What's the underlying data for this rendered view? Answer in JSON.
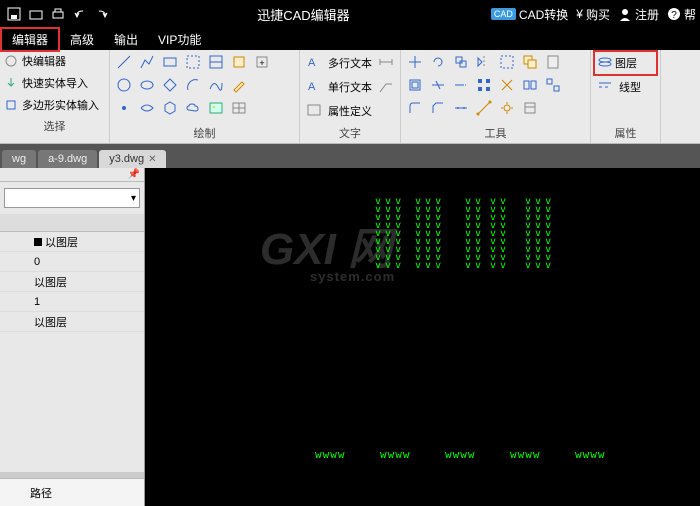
{
  "titlebar": {
    "title": "迅捷CAD编辑器",
    "cad_convert": "CAD转换",
    "buy": "购买",
    "register": "注册",
    "help": "帮"
  },
  "menubar": {
    "editor": "编辑器",
    "advanced": "高级",
    "output": "输出",
    "vip": "VIP功能"
  },
  "ribbon": {
    "left": {
      "quick_editor": "快编辑器",
      "quick_import": "快速实体导入",
      "poly_input": "多边形实体输入",
      "select": "选择"
    },
    "draw": "绘制",
    "text": {
      "multiline": "多行文本",
      "singleline": "单行文本",
      "attr_def": "属性定义",
      "label": "文字"
    },
    "tools": "工具",
    "attrs": {
      "layer": "图层",
      "linetype": "线型",
      "label": "属性"
    }
  },
  "tabs": [
    {
      "label": "wg"
    },
    {
      "label": "a-9.dwg"
    },
    {
      "label": "y3.dwg",
      "active": true
    }
  ],
  "leftpanel": {
    "rows": [
      {
        "c2": "以图层",
        "sq": true
      },
      {
        "c2": "0"
      },
      {
        "c2": "以图层"
      },
      {
        "c2": "1"
      },
      {
        "c2": "以图层"
      }
    ],
    "path": "路径"
  },
  "watermark": {
    "main": "GXI 网",
    "sub": "system.com"
  }
}
